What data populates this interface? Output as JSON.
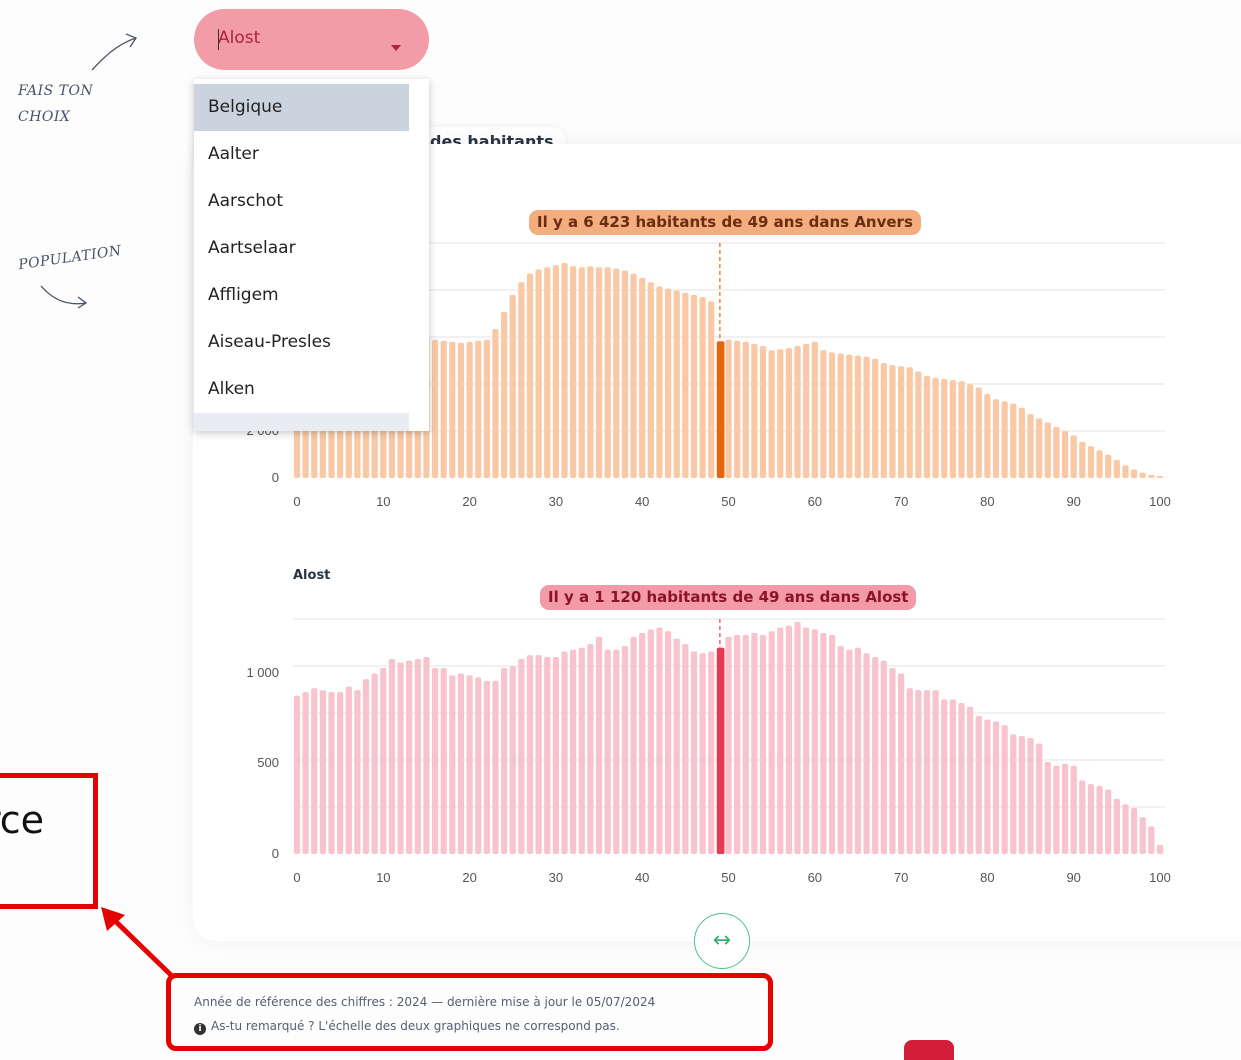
{
  "selector": {
    "value": "Alost",
    "options": [
      "Belgique",
      "Aalter",
      "Aarschot",
      "Aartselaar",
      "Affligem",
      "Aiseau-Presles",
      "Alken"
    ],
    "highlighted": "Belgique"
  },
  "side_notes": {
    "choice": "FAIS TON CHOIX",
    "population": "POPULATION"
  },
  "tab_title": "des habitants",
  "tooltips": {
    "top": "Il y a 6 423 habitants de 49 ans dans Anvers",
    "bottom": "Il y a 1 120 habitants de 49 ans dans Alost"
  },
  "footer": {
    "line1": "Année de référence des chiffres : 2024 — dernière mise à jour le 05/07/2024",
    "line2": "As-tu remarqué ? L'échelle des deux graphiques ne correspond pas."
  },
  "annotation": {
    "partial_text": "rce"
  },
  "swap_icon": "↔",
  "colors": {
    "anvers_bar": "#f9c9a5",
    "anvers_highlight": "#e4660f",
    "alost_bar": "#f8c3cd",
    "alost_highlight": "#e23b52",
    "accent_green": "#3aaf75"
  },
  "chart_data": [
    {
      "type": "bar",
      "title": "",
      "xlabel": "",
      "ylabel": "",
      "x_ticks": [
        "0",
        "10",
        "20",
        "30",
        "40",
        "50",
        "60",
        "70",
        "80",
        "90",
        "100"
      ],
      "y_ticks": [
        "0",
        "2 000"
      ],
      "highlight_age": 49,
      "highlight_value": 6423,
      "ylim": [
        0,
        12600
      ],
      "values": [
        5200,
        5300,
        5400,
        5450,
        5500,
        5550,
        5600,
        5700,
        5800,
        5900,
        6000,
        6050,
        6200,
        6400,
        6500,
        6600,
        6500,
        6450,
        6400,
        6350,
        6400,
        6450,
        6500,
        7000,
        7800,
        8600,
        9200,
        9600,
        9800,
        9900,
        10000,
        10100,
        9950,
        9900,
        9950,
        9900,
        9900,
        9850,
        9750,
        9600,
        9400,
        9200,
        9000,
        8900,
        8800,
        8700,
        8600,
        8500,
        8300,
        6423,
        6500,
        6450,
        6400,
        6300,
        6200,
        6000,
        6050,
        6100,
        6200,
        6300,
        6400,
        6000,
        5900,
        5850,
        5800,
        5750,
        5700,
        5600,
        5400,
        5300,
        5250,
        5200,
        5000,
        4800,
        4700,
        4650,
        4600,
        4550,
        4400,
        4250,
        3950,
        3700,
        3600,
        3500,
        3300,
        3000,
        2800,
        2600,
        2400,
        2200,
        2000,
        1700,
        1500,
        1300,
        1100,
        850,
        600,
        400,
        250,
        150,
        100
      ]
    },
    {
      "type": "bar",
      "title": "Alost",
      "xlabel": "",
      "ylabel": "",
      "x_ticks": [
        "0",
        "10",
        "20",
        "30",
        "40",
        "50",
        "60",
        "70",
        "80",
        "90",
        "100"
      ],
      "y_ticks": [
        "0",
        "500",
        "1 000"
      ],
      "highlight_age": 49,
      "highlight_value": 1120,
      "ylim": [
        0,
        1300
      ],
      "values": [
        860,
        880,
        900,
        890,
        880,
        880,
        910,
        890,
        950,
        980,
        1010,
        1060,
        1040,
        1050,
        1060,
        1070,
        1010,
        1010,
        970,
        980,
        970,
        960,
        940,
        940,
        1010,
        1020,
        1060,
        1080,
        1080,
        1070,
        1070,
        1100,
        1110,
        1120,
        1140,
        1180,
        1110,
        1110,
        1130,
        1180,
        1200,
        1220,
        1230,
        1210,
        1170,
        1140,
        1100,
        1090,
        1100,
        1120,
        1180,
        1190,
        1190,
        1200,
        1190,
        1210,
        1230,
        1240,
        1260,
        1230,
        1220,
        1200,
        1190,
        1130,
        1110,
        1120,
        1090,
        1070,
        1050,
        1010,
        980,
        900,
        890,
        890,
        890,
        840,
        840,
        820,
        800,
        750,
        730,
        720,
        700,
        650,
        640,
        630,
        600,
        500,
        480,
        490,
        480,
        400,
        380,
        370,
        350,
        300,
        270,
        250,
        200,
        150,
        50
      ]
    }
  ]
}
